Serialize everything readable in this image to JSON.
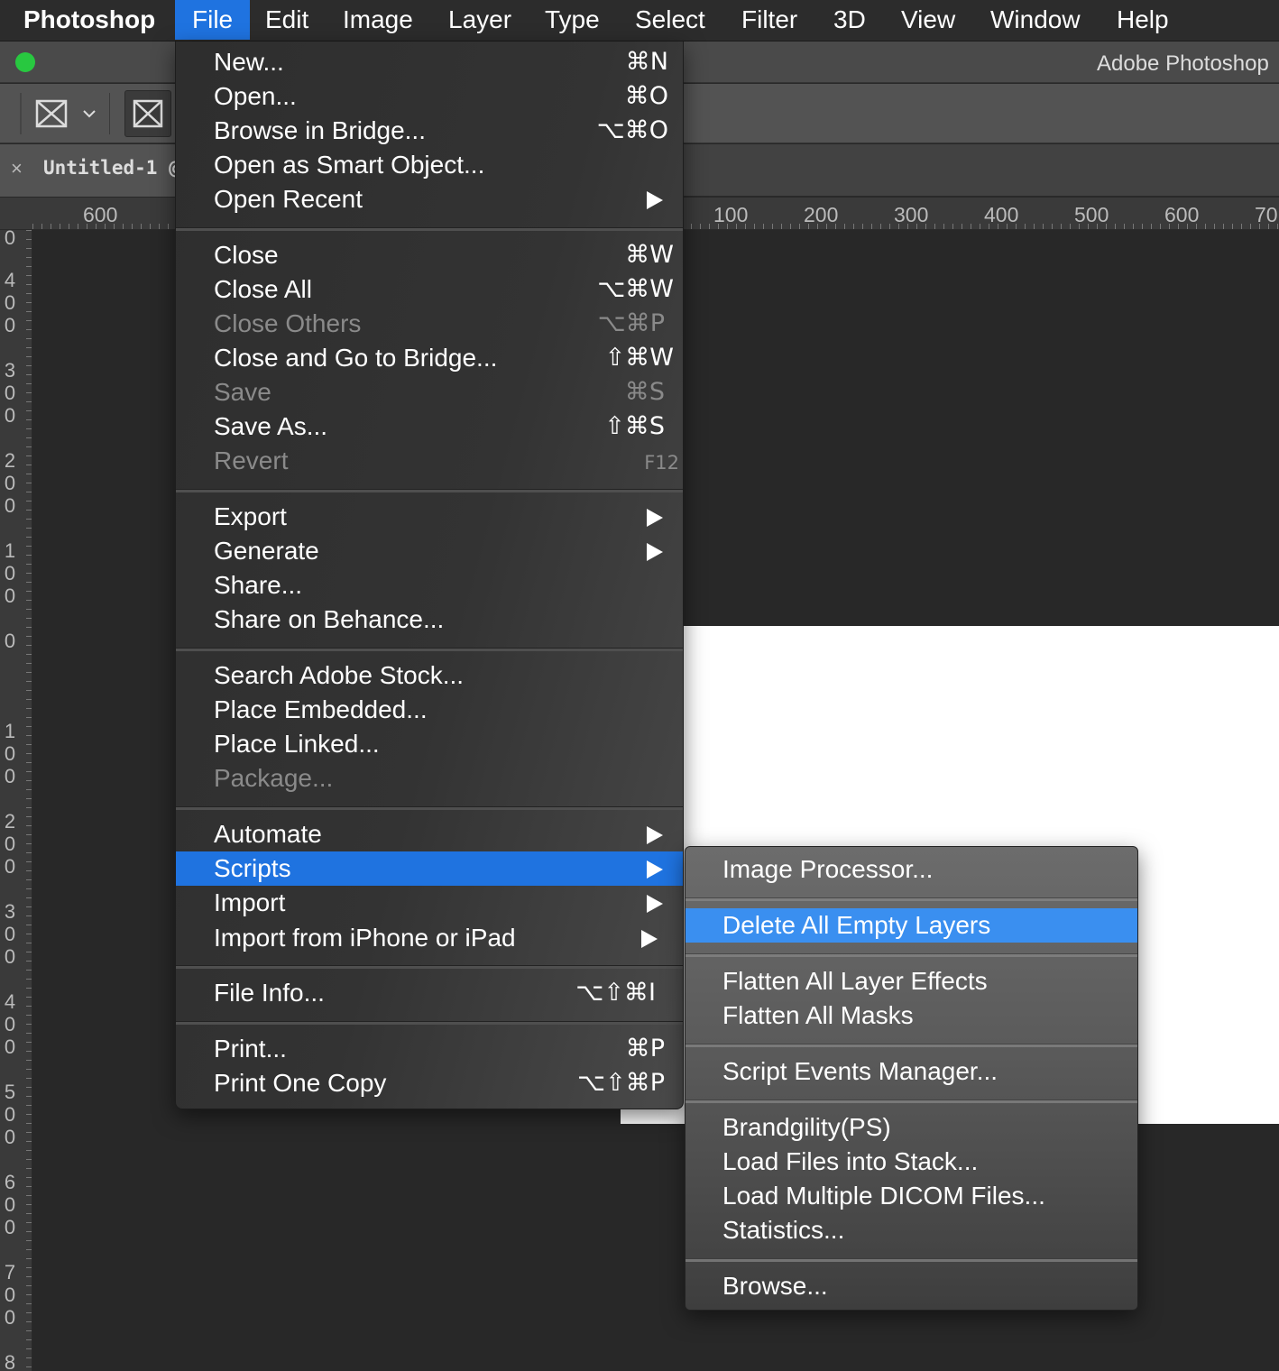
{
  "menubar": {
    "app": "Photoshop",
    "items": [
      "File",
      "Edit",
      "Image",
      "Layer",
      "Type",
      "Select",
      "Filter",
      "3D",
      "View",
      "Window",
      "Help"
    ],
    "active": "File"
  },
  "window": {
    "title": "Adobe Photoshop"
  },
  "document": {
    "tab_title": "Untitled-1 @",
    "tab_close": "×"
  },
  "rulers": {
    "horizontal": [
      "600",
      "100",
      "200",
      "300",
      "400",
      "500",
      "600",
      "70"
    ],
    "vertical": [
      "0",
      "400",
      "300",
      "200",
      "100",
      "0",
      "100",
      "200",
      "300",
      "400",
      "500",
      "600",
      "700",
      "8"
    ]
  },
  "file_menu": {
    "groups": [
      [
        {
          "label": "New...",
          "shortcut": "⌘N"
        },
        {
          "label": "Open...",
          "shortcut": "⌘O"
        },
        {
          "label": "Browse in Bridge...",
          "shortcut": "⌥⌘O"
        },
        {
          "label": "Open as Smart Object...",
          "shortcut": ""
        },
        {
          "label": "Open Recent",
          "submenu": true
        }
      ],
      [
        {
          "label": "Close",
          "shortcut": "⌘W"
        },
        {
          "label": "Close All",
          "shortcut": "⌥⌘W"
        },
        {
          "label": "Close Others",
          "shortcut": "⌥⌘P",
          "disabled": true
        },
        {
          "label": "Close and Go to Bridge...",
          "shortcut": "⇧⌘W"
        },
        {
          "label": "Save",
          "shortcut": "⌘S",
          "disabled": true
        },
        {
          "label": "Save As...",
          "shortcut": "⇧⌘S"
        },
        {
          "label": "Revert",
          "shortcut": "F12",
          "disabled": true
        }
      ],
      [
        {
          "label": "Export",
          "submenu": true
        },
        {
          "label": "Generate",
          "submenu": true
        },
        {
          "label": "Share...",
          "shortcut": ""
        },
        {
          "label": "Share on Behance...",
          "shortcut": ""
        }
      ],
      [
        {
          "label": "Search Adobe Stock...",
          "shortcut": ""
        },
        {
          "label": "Place Embedded...",
          "shortcut": ""
        },
        {
          "label": "Place Linked...",
          "shortcut": ""
        },
        {
          "label": "Package...",
          "shortcut": "",
          "disabled": true
        }
      ],
      [
        {
          "label": "Automate",
          "submenu": true
        },
        {
          "label": "Scripts",
          "submenu": true,
          "highlighted": true
        },
        {
          "label": "Import",
          "submenu": true
        },
        {
          "label": "Import from iPhone or iPad",
          "submenu": true
        }
      ],
      [
        {
          "label": "File Info...",
          "shortcut": "⌥⇧⌘I"
        }
      ],
      [
        {
          "label": "Print...",
          "shortcut": "⌘P"
        },
        {
          "label": "Print One Copy",
          "shortcut": "⌥⇧⌘P"
        }
      ]
    ]
  },
  "scripts_menu": {
    "groups": [
      [
        {
          "label": "Image Processor..."
        }
      ],
      [
        {
          "label": "Delete All Empty Layers",
          "highlighted": true
        }
      ],
      [
        {
          "label": "Flatten All Layer Effects"
        },
        {
          "label": "Flatten All Masks"
        }
      ],
      [
        {
          "label": "Script Events Manager..."
        }
      ],
      [
        {
          "label": "Brandgility(PS)"
        },
        {
          "label": "Load Files into Stack..."
        },
        {
          "label": "Load Multiple DICOM Files..."
        },
        {
          "label": "Statistics..."
        }
      ],
      [
        {
          "label": "Browse..."
        }
      ]
    ]
  },
  "colors": {
    "highlight": "#1f73e0",
    "submenu_highlight": "#3a8ff0",
    "traffic_green": "#28c840"
  },
  "icons": {
    "tool_a": "frame-tool-icon",
    "tool_a_dropdown": "chevron-down-icon",
    "tool_b": "frame-tool-icon",
    "submenu": "triangle-right-icon"
  }
}
